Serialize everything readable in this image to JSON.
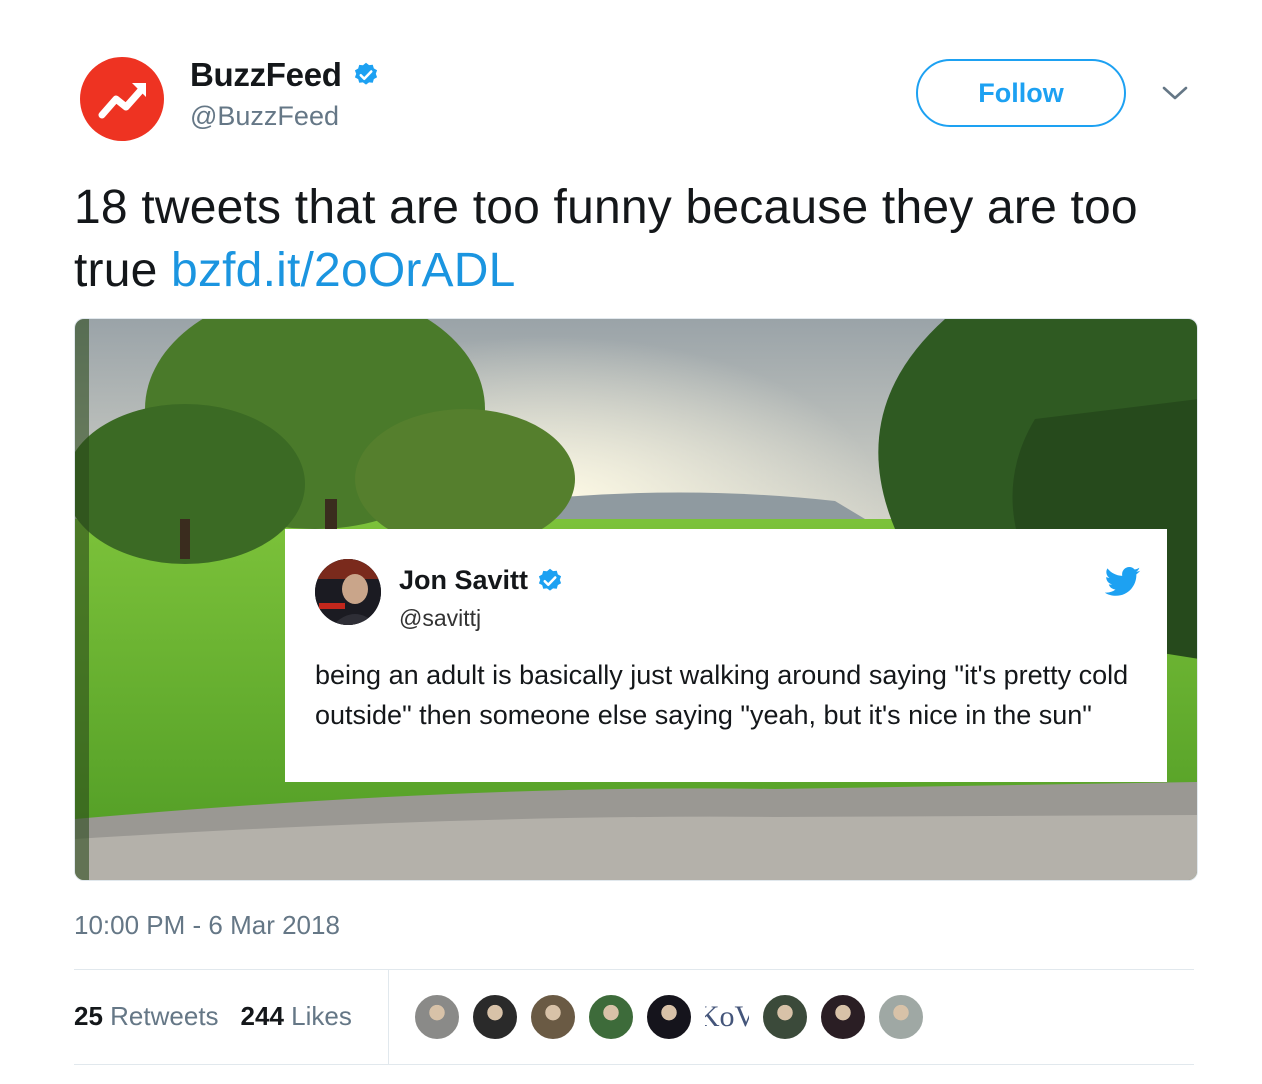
{
  "author": {
    "name": "BuzzFeed",
    "handle": "@BuzzFeed",
    "avatar_icon": "buzzfeed-trending-arrow-icon",
    "avatar_color": "#ee3322",
    "verified_icon": "verified-badge-icon"
  },
  "follow_button": {
    "label": "Follow",
    "color": "#1da1f2"
  },
  "menu_icon": "chevron-down-icon",
  "tweet": {
    "text": "18 tweets that are too funny because they are too true ",
    "link": "bzfd.it/2oOrADL",
    "link_color": "#1b95e0",
    "timestamp": "10:00 PM - 6 Mar 2018"
  },
  "embedded_card": {
    "name": "Jon Savitt",
    "handle": "@savittj",
    "text": "being an adult is basically just walking around saying \"it's pretty cold outside\" then someone else saying \"yeah, but it's nice in the sun\"",
    "brand_icon": "twitter-bird-icon"
  },
  "stats": {
    "retweets_count": "25",
    "retweets_label": "Retweets",
    "likes_count": "244",
    "likes_label": "Likes"
  },
  "likers": [
    {
      "name": "liker-avatar-1",
      "color": "#8a8a88"
    },
    {
      "name": "liker-avatar-2",
      "color": "#2a2a2a"
    },
    {
      "name": "liker-avatar-3",
      "color": "#6a5a44"
    },
    {
      "name": "liker-avatar-4",
      "color": "#3d6b3a"
    },
    {
      "name": "liker-avatar-5",
      "color": "#15141c"
    },
    {
      "name": "liker-avatar-6",
      "label": "KoV"
    },
    {
      "name": "liker-avatar-7",
      "color": "#3b4a3a"
    },
    {
      "name": "liker-avatar-8",
      "color": "#2a1e24"
    },
    {
      "name": "liker-avatar-9",
      "color": "#9fa8a4"
    }
  ]
}
